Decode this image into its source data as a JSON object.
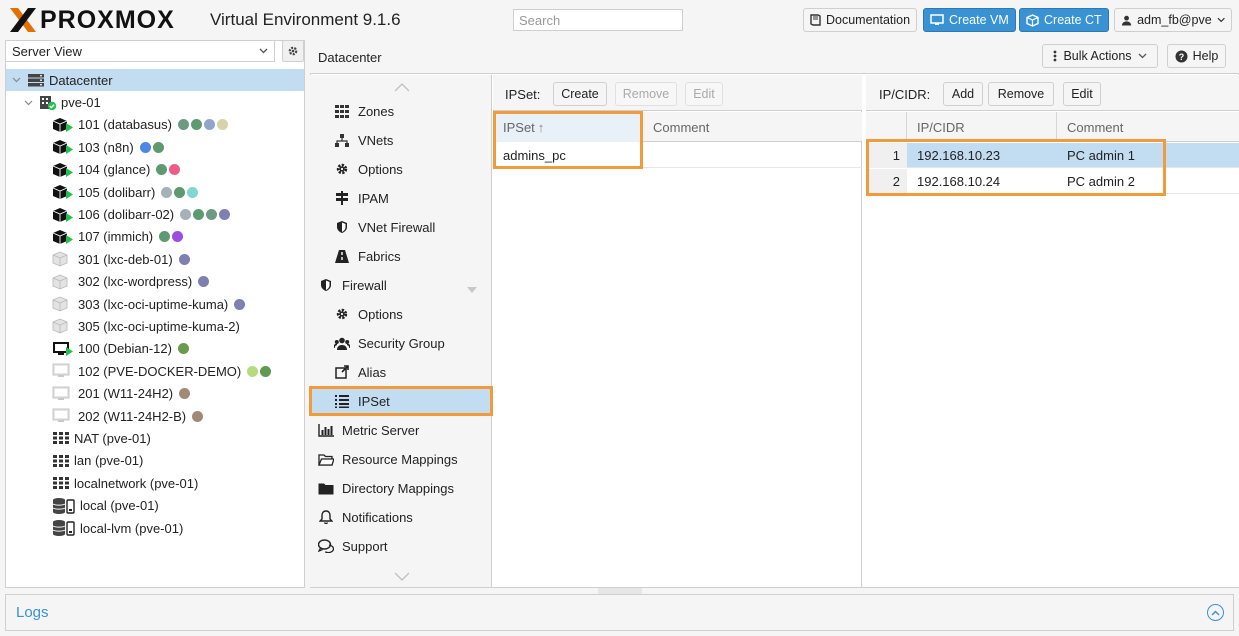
{
  "header": {
    "brand": "PROXMOX",
    "title": "Virtual Environment 9.1.6",
    "search_placeholder": "Search",
    "documentation": "Documentation",
    "create_vm": "Create VM",
    "create_ct": "Create CT",
    "user": "adm_fb@pve"
  },
  "left": {
    "view": "Server View",
    "tree": [
      {
        "label": "Datacenter",
        "icon": "datacenter-icon",
        "level": 0,
        "selected": true,
        "tags": []
      },
      {
        "label": "pve-01",
        "icon": "node-icon",
        "level": 1,
        "tags": []
      },
      {
        "label": "101 (databasus)",
        "icon": "running-container-icon",
        "level": 2,
        "tags": [
          "#6f9a82",
          "#5e9a70",
          "#8ea5d0",
          "#d6d3a8"
        ]
      },
      {
        "label": "103 (n8n)",
        "icon": "running-container-icon",
        "level": 2,
        "tags": [
          "#4e86e8",
          "#5e9a70"
        ]
      },
      {
        "label": "104 (glance)",
        "icon": "running-container-icon",
        "level": 2,
        "tags": [
          "#5e9a70",
          "#ee5b86"
        ]
      },
      {
        "label": "105 (dolibarr)",
        "icon": "running-container-icon",
        "level": 2,
        "tags": [
          "#a6b0b8",
          "#5e9a70",
          "#7fd7d0"
        ]
      },
      {
        "label": "106 (dolibarr-02)",
        "icon": "running-container-icon",
        "level": 2,
        "tags": [
          "#a6b0b8",
          "#5e9a70",
          "#6f9a82",
          "#7d80b0"
        ]
      },
      {
        "label": "107 (immich)",
        "icon": "running-container-icon",
        "level": 2,
        "tags": [
          "#5e9a70",
          "#9b4ee0"
        ]
      },
      {
        "label": "301 (lxc-deb-01)",
        "icon": "stopped-container-icon",
        "level": 2,
        "tags": [
          "#7d80b0"
        ]
      },
      {
        "label": "302 (lxc-wordpress)",
        "icon": "stopped-container-icon",
        "level": 2,
        "tags": [
          "#7d80b0"
        ]
      },
      {
        "label": "303 (lxc-oci-uptime-kuma)",
        "icon": "stopped-container-icon",
        "level": 2,
        "tags": [
          "#7d80b0"
        ]
      },
      {
        "label": "305 (lxc-oci-uptime-kuma-2)",
        "icon": "stopped-container-icon",
        "level": 2,
        "tags": []
      },
      {
        "label": "100 (Debian-12)",
        "icon": "running-vm-icon",
        "level": 2,
        "tags": [
          "#6c9a4c"
        ]
      },
      {
        "label": "102 (PVE-DOCKER-DEMO)",
        "icon": "stopped-vm-icon",
        "level": 2,
        "tags": [
          "#b4dc7c",
          "#5e9a50"
        ]
      },
      {
        "label": "201 (W11-24H2)",
        "icon": "stopped-vm-icon",
        "level": 2,
        "tags": [
          "#a08a76"
        ]
      },
      {
        "label": "202 (W11-24H2-B)",
        "icon": "stopped-vm-icon",
        "level": 2,
        "tags": [
          "#a08a76"
        ]
      },
      {
        "label": "NAT (pve-01)",
        "icon": "network-grid-icon",
        "level": 2,
        "tags": []
      },
      {
        "label": "lan (pve-01)",
        "icon": "network-grid-icon",
        "level": 2,
        "tags": []
      },
      {
        "label": "localnetwork (pve-01)",
        "icon": "network-grid-icon",
        "level": 2,
        "tags": []
      },
      {
        "label": "local (pve-01)",
        "icon": "storage-icon",
        "level": 2,
        "tags": []
      },
      {
        "label": "local-lvm (pve-01)",
        "icon": "storage-icon",
        "level": 2,
        "tags": []
      }
    ]
  },
  "main": {
    "title": "Datacenter",
    "bulk_actions": "Bulk Actions",
    "help": "Help",
    "nav": [
      {
        "label": "Zones",
        "icon": "grid-icon",
        "indent": true
      },
      {
        "label": "VNets",
        "icon": "sitemap-icon",
        "indent": true
      },
      {
        "label": "Options",
        "icon": "gear-icon",
        "indent": true
      },
      {
        "label": "IPAM",
        "icon": "signpost-icon",
        "indent": true
      },
      {
        "label": "VNet Firewall",
        "icon": "shield-icon",
        "indent": true
      },
      {
        "label": "Fabrics",
        "icon": "road-icon",
        "indent": true
      },
      {
        "label": "Firewall",
        "icon": "shield-icon",
        "indent": false,
        "expander": true
      },
      {
        "label": "Options",
        "icon": "gear-icon",
        "indent": true
      },
      {
        "label": "Security Group",
        "icon": "users-icon",
        "indent": true
      },
      {
        "label": "Alias",
        "icon": "external-link-icon",
        "indent": true
      },
      {
        "label": "IPSet",
        "icon": "list-icon",
        "indent": true,
        "selected": true
      },
      {
        "label": "Metric Server",
        "icon": "bar-chart-icon",
        "indent": false
      },
      {
        "label": "Resource Mappings",
        "icon": "folder-open-icon",
        "indent": false
      },
      {
        "label": "Directory Mappings",
        "icon": "folder-icon",
        "indent": false
      },
      {
        "label": "Notifications",
        "icon": "bell-icon",
        "indent": false
      },
      {
        "label": "Support",
        "icon": "comments-icon",
        "indent": false
      }
    ],
    "ipset": {
      "label": "IPSet:",
      "create": "Create",
      "remove": "Remove",
      "edit": "Edit",
      "columns": [
        "IPSet",
        "Comment"
      ],
      "sort_arrow": "↑",
      "rows": [
        {
          "name": "admins_pc",
          "comment": ""
        }
      ]
    },
    "cidr": {
      "label": "IP/CIDR:",
      "add": "Add",
      "remove": "Remove",
      "edit": "Edit",
      "columns": [
        "IP/CIDR",
        "Comment"
      ],
      "rows": [
        {
          "num": "1",
          "cidr": "192.168.10.23",
          "comment": "PC admin 1"
        },
        {
          "num": "2",
          "cidr": "192.168.10.24",
          "comment": "PC admin 2"
        }
      ]
    }
  },
  "logs": {
    "title": "Logs"
  },
  "colors": {
    "accent": "#3892d4",
    "highlight": "#f29b3a",
    "selected": "#c2ddf2",
    "brand_orange": "#e57000"
  }
}
